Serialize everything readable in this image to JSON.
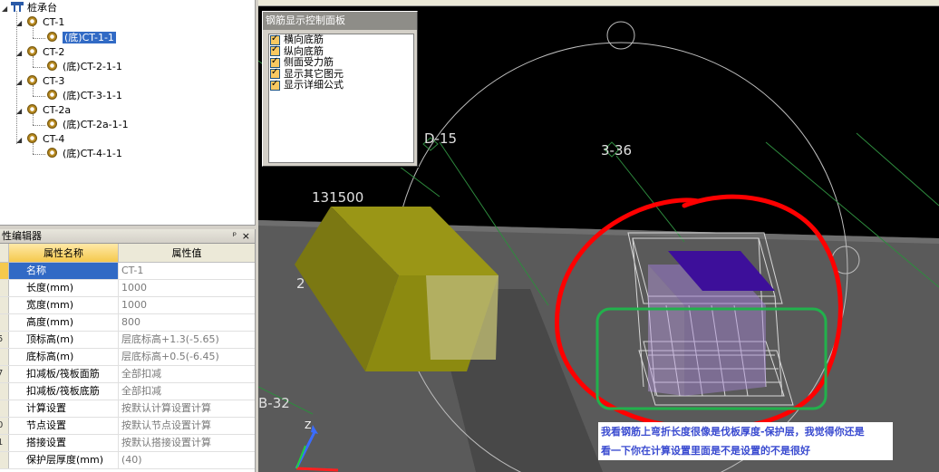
{
  "tree": {
    "root": "桩承台",
    "groups": [
      {
        "name": "CT-1",
        "child": "(底)CT-1-1",
        "selected": true
      },
      {
        "name": "CT-2",
        "child": "(底)CT-2-1-1"
      },
      {
        "name": "CT-3",
        "child": "(底)CT-3-1-1"
      },
      {
        "name": "CT-2a",
        "child": "(底)CT-2a-1-1"
      },
      {
        "name": "CT-4",
        "child": "(底)CT-4-1-1"
      }
    ]
  },
  "props": {
    "title": "性编辑器",
    "pin": "ᵖ",
    "close": "×",
    "col_name": "属性名称",
    "col_value": "属性值",
    "rows": [
      {
        "idx": "",
        "name": "名称",
        "value": "CT-1"
      },
      {
        "idx": "",
        "name": "长度(mm)",
        "value": "1000"
      },
      {
        "idx": "",
        "name": "宽度(mm)",
        "value": "1000"
      },
      {
        "idx": "",
        "name": "高度(mm)",
        "value": "800"
      },
      {
        "idx": "5",
        "name": "顶标高(m)",
        "value": "层底标高+1.3(-5.65)"
      },
      {
        "idx": "",
        "name": "底标高(m)",
        "value": "层底标高+0.5(-6.45)"
      },
      {
        "idx": "7",
        "name": "扣减板/筏板面筋",
        "value": "全部扣减"
      },
      {
        "idx": "",
        "name": "扣减板/筏板底筋",
        "value": "全部扣减"
      },
      {
        "idx": "",
        "name": "计算设置",
        "value": "按默认计算设置计算"
      },
      {
        "idx": "0",
        "name": "节点设置",
        "value": "按默认节点设置计算"
      },
      {
        "idx": "1",
        "name": "搭接设置",
        "value": "按默认搭接设置计算"
      },
      {
        "idx": "",
        "name": "保护层厚度(mm)",
        "value": "(40)"
      }
    ]
  },
  "control_panel": {
    "title": "钢筋显示控制面板",
    "options": [
      "横向底筋",
      "纵向底筋",
      "侧面受力筋",
      "显示其它图元",
      "显示详细公式"
    ]
  },
  "viewport": {
    "labels": {
      "axis_d15": "D-15",
      "axis_336": "3-36",
      "elev": "131500",
      "left_digit": "2",
      "axis_b32": "B-32"
    },
    "axis_letter_z": "Z"
  },
  "annotation": {
    "line1": "我看钢筋上弯折长度很像是伐板厚度-保护层，我觉得你还是",
    "line2": "看一下你在计算设置里面是不是设置的不是很好"
  },
  "colors": {
    "selection": "#316ac5",
    "header_gold": "#f5c94d",
    "red_mark": "#ff0000",
    "green_mark": "#22b14c",
    "cap_block": "#8c8a10",
    "rebar_purple": "#4b1aa0"
  }
}
